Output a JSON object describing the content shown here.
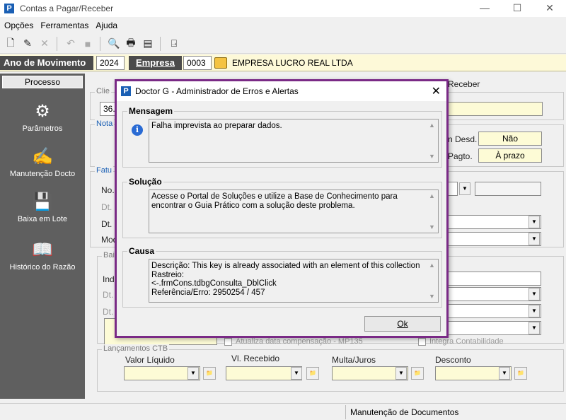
{
  "window": {
    "title": "Contas a Pagar/Receber",
    "controls": [
      "—",
      "☐",
      "✕"
    ]
  },
  "menu": [
    "Opções",
    "Ferramentas",
    "Ajuda"
  ],
  "yearbar": {
    "ano_label": "Ano de Movimento",
    "ano_value": "2024",
    "empresa_label": "Empresa",
    "empresa_code": "0003",
    "empresa_name": "EMPRESA LUCRO REAL LTDA"
  },
  "sidebar": {
    "header": "Processo",
    "items": [
      {
        "label": "Parâmetros",
        "icon": "gears-icon"
      },
      {
        "label": "Manutenção Docto",
        "icon": "pencil-paper-icon"
      },
      {
        "label": "Baixa em Lote",
        "icon": "disk-batch-icon"
      },
      {
        "label": "Histórico do Razão",
        "icon": "book-icon"
      }
    ]
  },
  "form": {
    "tab_right_label": "Receber",
    "cliente_group": "Clie",
    "cliente_code": "36.",
    "notas_group": "Nota",
    "desd_label": "n Desd.",
    "desd_value": "Não",
    "pagto_label": "Pagto.",
    "pagto_value": "À prazo",
    "fatura_group": "Fatu",
    "no_label": "No.",
    "dt1_label": "Dt.",
    "dt2_label": "Dt.",
    "mod_label": "Mod",
    "baixa_group": "Baix",
    "ind_label": "Ind",
    "dt3_label": "Dt.",
    "dt4_label": "Dt.",
    "atualiza_label": "Atualiza data compensação - MP135",
    "integra_label": "Integra Contabilidade",
    "lanc_group": "Lançamentos CTB",
    "col_valor": "Valor Líquido",
    "col_recebido": "Vl. Recebido",
    "col_multa": "Multa/Juros",
    "col_desconto": "Desconto"
  },
  "status": {
    "text": "Manutenção de Documentos"
  },
  "dialog": {
    "title": "Doctor G - Administrador de Erros e Alertas",
    "mensagem_label": "Mensagem",
    "mensagem_text": "Falha imprevista ao preparar dados.",
    "solucao_label": "Solução",
    "solucao_text": "Acesse o Portal de Soluções e utilize a Base de Conhecimento para encontrar o Guia Prático com a solução deste problema.",
    "causa_label": "Causa",
    "causa_lines": [
      "Descrição: This key is already associated with an element of this collection",
      "Rastreio:",
      "<-.frmCons.tdbgConsulta_DblClick",
      "Referência/Erro: 2950254 / 457"
    ],
    "ok_label": "Ok"
  }
}
